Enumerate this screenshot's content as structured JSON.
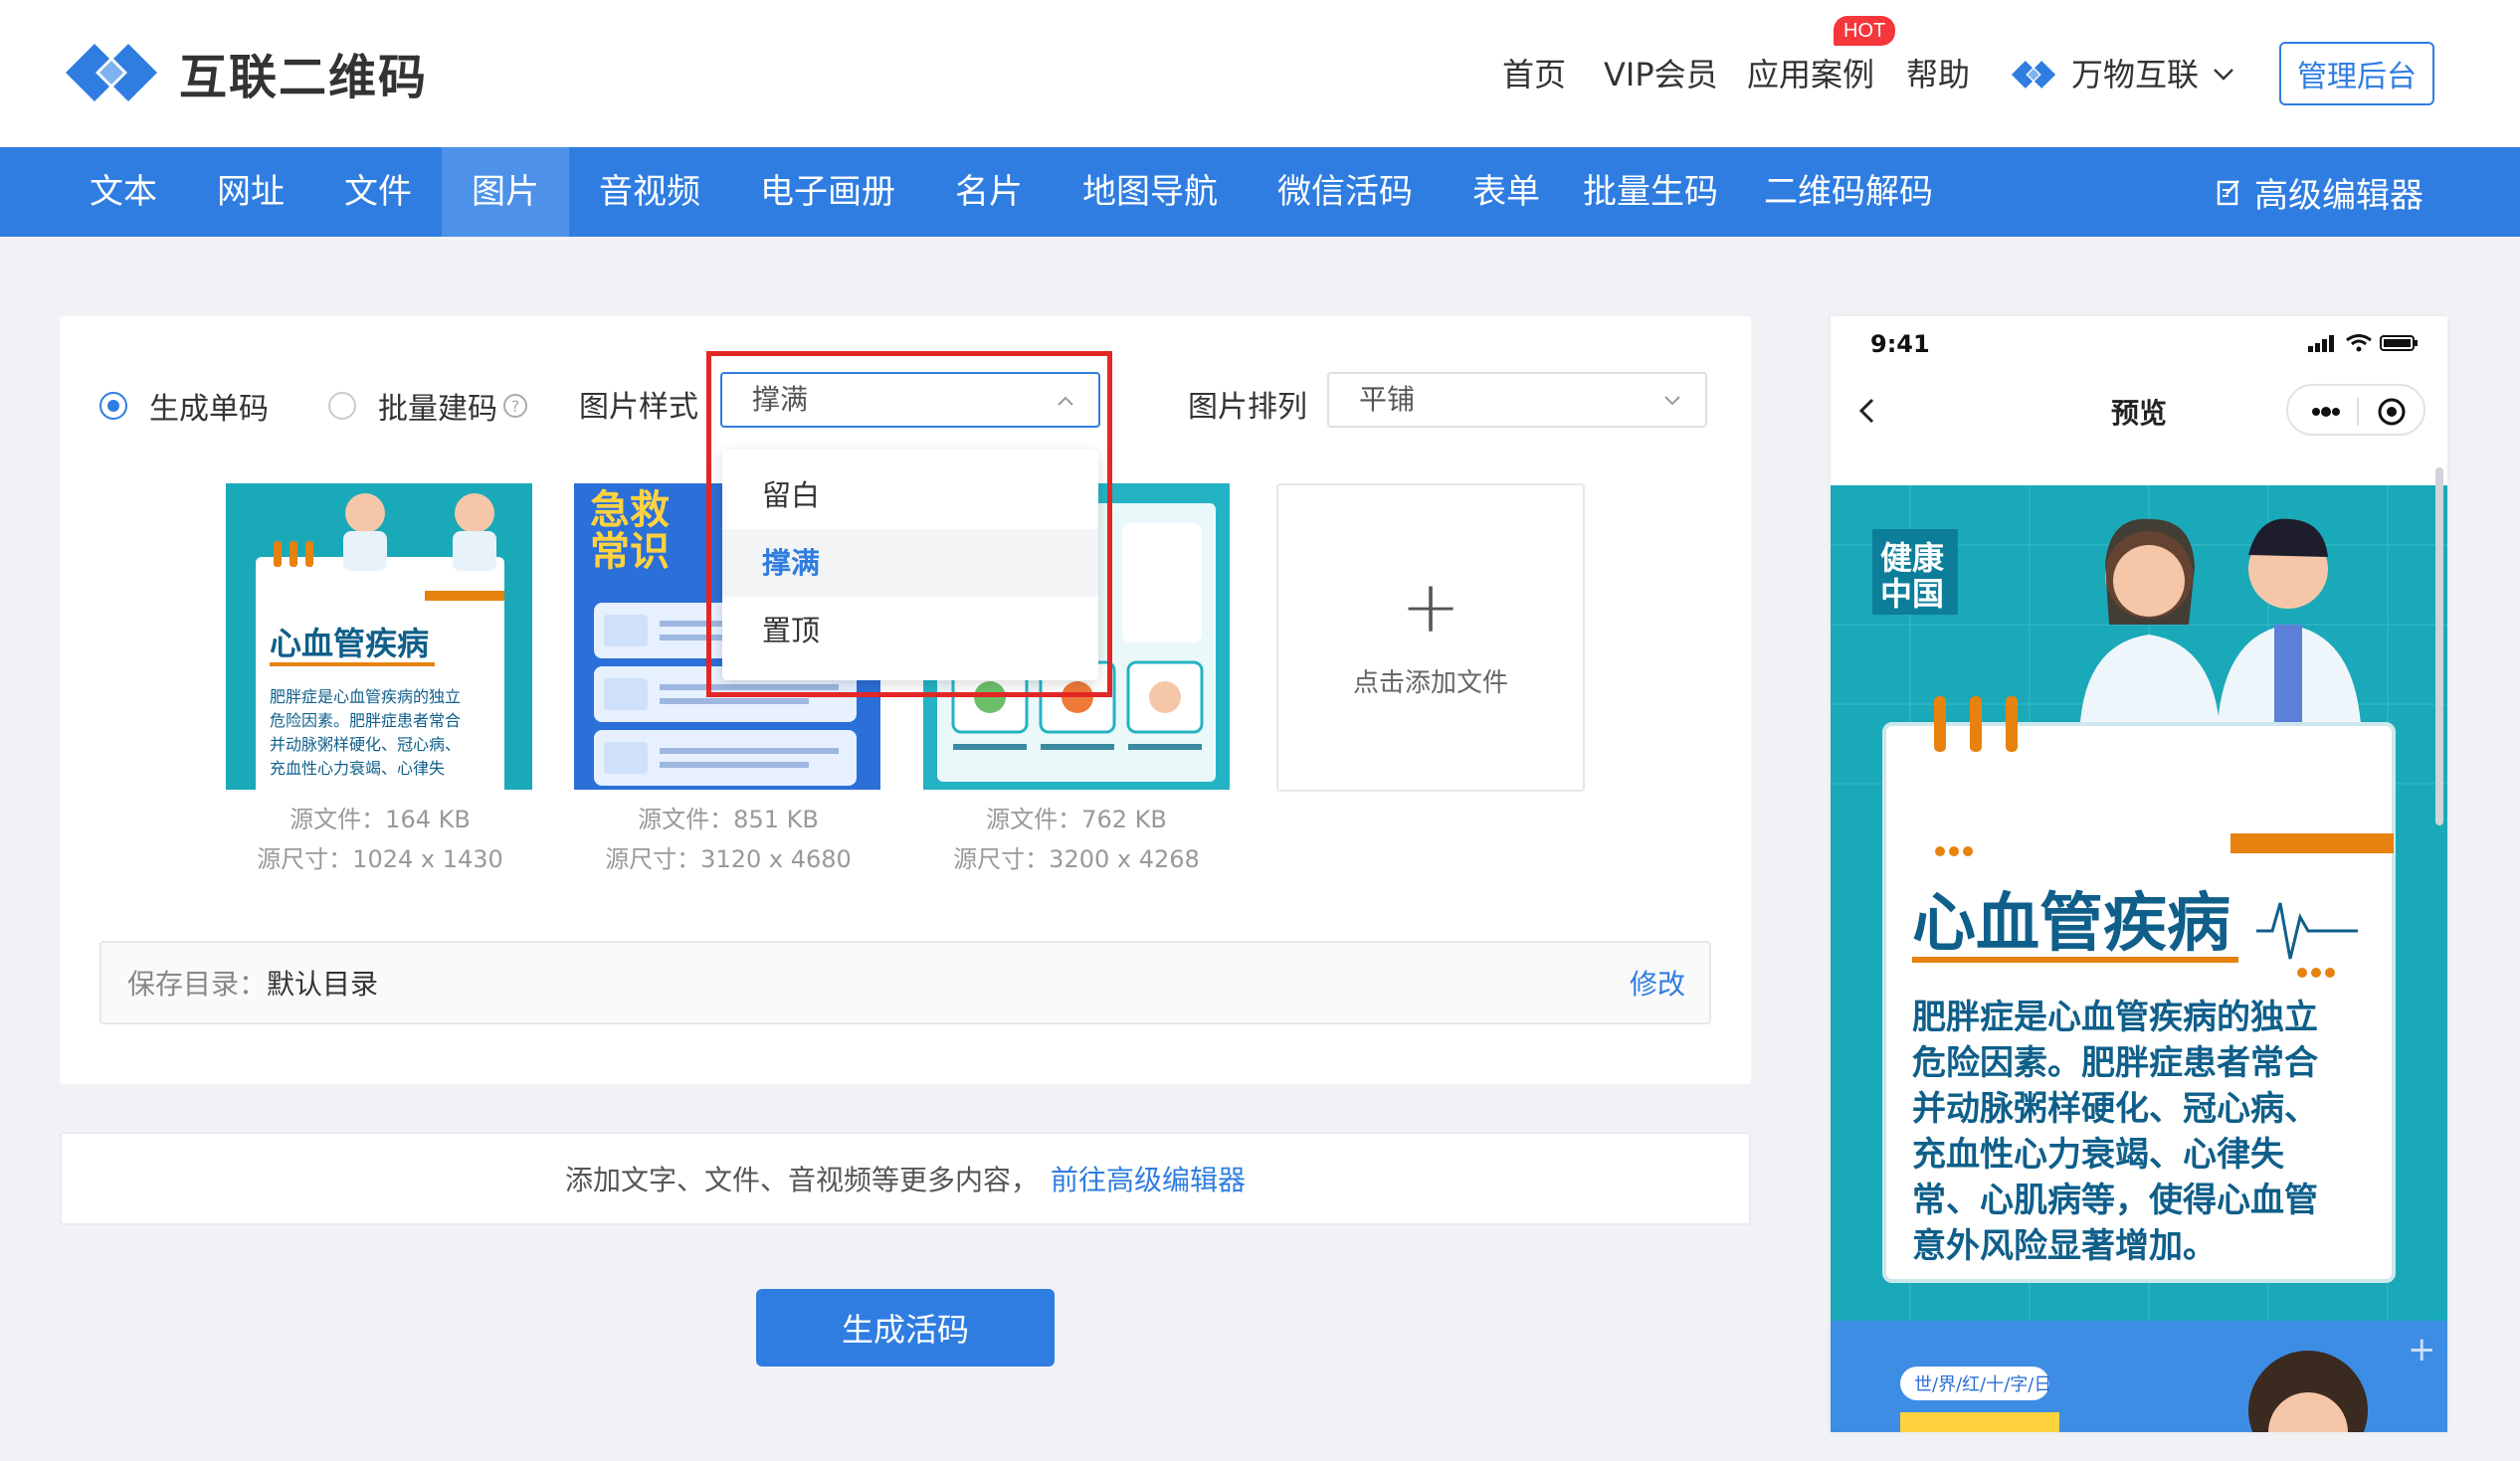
{
  "brand": {
    "name": "互联二维码"
  },
  "topnav": {
    "items": [
      {
        "label": "首页"
      },
      {
        "label": "VIP会员"
      },
      {
        "label": "应用案例"
      },
      {
        "label": "帮助"
      }
    ],
    "hot_badge": "HOT",
    "company": "万物互联",
    "admin_button": "管理后台"
  },
  "tabs": {
    "items": [
      {
        "label": "文本"
      },
      {
        "label": "网址"
      },
      {
        "label": "文件"
      },
      {
        "label": "图片"
      },
      {
        "label": "音视频"
      },
      {
        "label": "电子画册"
      },
      {
        "label": "名片"
      },
      {
        "label": "地图导航"
      },
      {
        "label": "微信活码"
      },
      {
        "label": "表单"
      },
      {
        "label": "批量生码"
      },
      {
        "label": "二维码解码"
      }
    ],
    "active": "图片",
    "advanced_editor": "高级编辑器"
  },
  "form": {
    "mode_single": "生成单码",
    "mode_batch": "批量建码",
    "help_glyph": "?",
    "style_label": "图片样式",
    "style_value": "撑满",
    "arrange_label": "图片排列",
    "arrange_value": "平铺",
    "style_options": [
      {
        "label": "留白"
      },
      {
        "label": "撑满"
      },
      {
        "label": "置顶"
      }
    ],
    "selected_option": "撑满"
  },
  "thumbnails": [
    {
      "file_size": "源文件：164 KB",
      "dimensions": "源尺寸：1024 x 1430"
    },
    {
      "file_size": "源文件：851 KB",
      "dimensions": "源尺寸：3120 x 4680"
    },
    {
      "file_size": "源文件：762 KB",
      "dimensions": "源尺寸：3200 x 4268"
    }
  ],
  "thumb_text": {
    "t1_title": "心血管疾病",
    "t1_body": "肥胖症是心血管疾病的独立危险因素。肥胖症患者常合并动脉粥样硬化、冠心病、充血性心力衰竭、心律失常、心肌病等，使得心血管",
    "t2_title1": "急救",
    "t2_title2": "常识"
  },
  "add_file": "点击添加文件",
  "save_dir": {
    "label": "保存目录：",
    "value": "默认目录",
    "edit": "修改"
  },
  "info_bar": {
    "text": "添加文字、文件、音视频等更多内容，",
    "link": "前往高级编辑器"
  },
  "generate_button": "生成活码",
  "preview": {
    "time": "9:41",
    "title": "预览",
    "badge": "健康\n中国",
    "poster_title": "心血管疾病",
    "poster_body": "肥胖症是心血管疾病的独立危险因素。肥胖症患者常合并动脉粥样硬化、冠心病、充血性心力衰竭、心律失常、心肌病等，使得心血管意外风险显著增加。",
    "bottom_tag": "世/界/红/十/字/日"
  },
  "colors": {
    "primary": "#2f7de1",
    "highlight_box": "#e32626",
    "hot": "#f5363a",
    "poster_teal": "#1aa9b8",
    "poster_text": "#0f5f8a"
  }
}
